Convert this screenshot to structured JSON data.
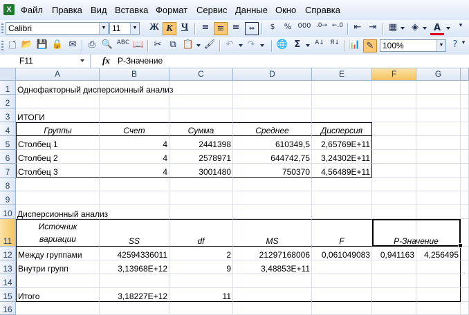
{
  "menu": {
    "items": [
      "Файл",
      "Правка",
      "Вид",
      "Вставка",
      "Формат",
      "Сервис",
      "Данные",
      "Окно",
      "Справка"
    ]
  },
  "format_toolbar": {
    "font_name": "Calibri",
    "font_size": "11",
    "bold": "Ж",
    "italic": "К",
    "underline": "Ч",
    "percent": "%",
    "thousands": "000"
  },
  "standard_toolbar": {
    "zoom": "100%",
    "sum": "Σ"
  },
  "formula_bar": {
    "cell_ref": "F11",
    "fx": "fx",
    "content": "P-Значение"
  },
  "columns": [
    "A",
    "B",
    "C",
    "D",
    "E",
    "F",
    "G"
  ],
  "rows": [
    "1",
    "2",
    "3",
    "4",
    "5",
    "6",
    "7",
    "8",
    "9",
    "10",
    "11",
    "12",
    "13",
    "14",
    "15",
    "16"
  ],
  "cells": {
    "a1": "Однофакторный дисперсионный анализ",
    "a3": "ИТОГИ",
    "h4": [
      "Группы",
      "Счет",
      "Сумма",
      "Среднее",
      "Дисперсия"
    ],
    "r5": [
      "Столбец 1",
      "4",
      "2441398",
      "610349,5",
      "2,65769E+11"
    ],
    "r6": [
      "Столбец 2",
      "4",
      "2578971",
      "644742,75",
      "3,24302E+11"
    ],
    "r7": [
      "Столбец 3",
      "4",
      "3001480",
      "750370",
      "4,56489E+11"
    ],
    "a10": "Дисперсионный анализ",
    "h11_a_top": "Источник",
    "h11_a_bottom": "вариации",
    "h11": [
      "SS",
      "df",
      "MS",
      "F",
      "P-Значение"
    ],
    "r12": [
      "Между группами",
      "42594336011",
      "2",
      "21297168006",
      "0,061049083",
      "0,941163",
      "4,256495"
    ],
    "r13": [
      "Внутри групп",
      "3,13968E+12",
      "9",
      "3,48853E+11"
    ],
    "r15": [
      "Итого",
      "3,18227E+12",
      "11"
    ]
  },
  "icons": [
    "app-excel-icon",
    "new-icon",
    "open-icon",
    "save-icon",
    "print-icon",
    "cut-icon",
    "copy-icon",
    "paste-icon",
    "undo-icon",
    "redo-icon",
    "sort-icon",
    "chart-icon",
    "help-icon"
  ]
}
